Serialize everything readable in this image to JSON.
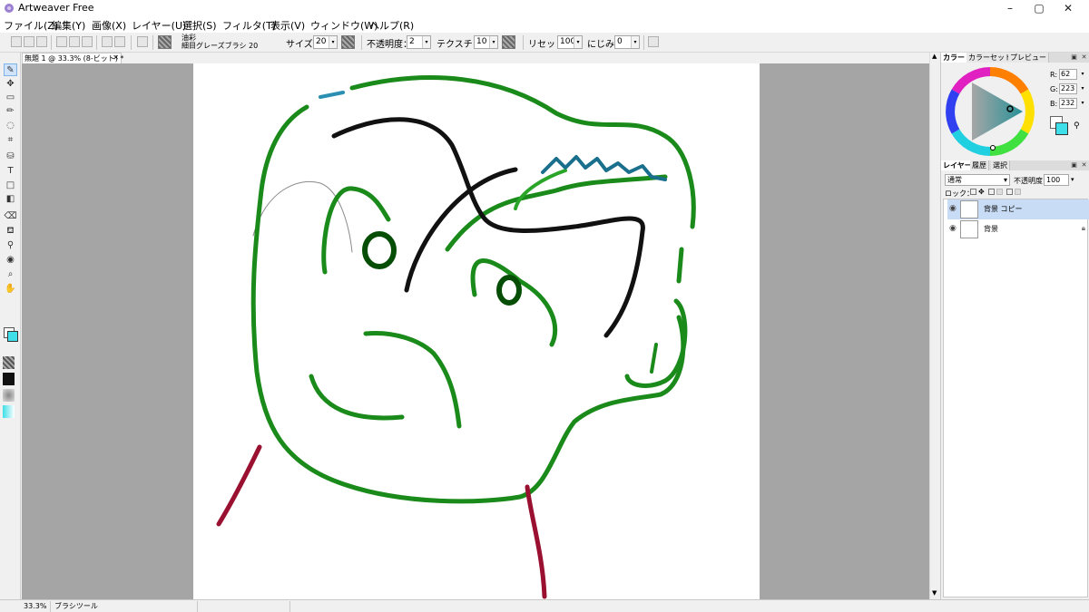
{
  "window": {
    "title": "Artweaver Free",
    "min": "–",
    "max": "▢",
    "close": "✕"
  },
  "menu": [
    "ファイル(Z)",
    "編集(Y)",
    "画像(X)",
    "レイヤー(U)",
    "選択(S)",
    "フィルタ(T)",
    "表示(V)",
    "ウィンドウ(W)",
    "ヘルプ(R)"
  ],
  "toolbar": {
    "brush_category": "油彩",
    "brush_name": "細目グレーズブラシ 20",
    "size_label": "サイズ：",
    "size_value": "20",
    "opacity_label": "不透明度：",
    "opacity_value": "2",
    "texture_label": "テクスチャ：",
    "texture_value": "10",
    "reset_label": "リセット：",
    "reset_value": "100",
    "blur_label": "にじみ：",
    "blur_value": "0"
  },
  "document": {
    "tab_title": "無題 1 @ 33.3% (8-ビット) *",
    "close": "✕"
  },
  "status": {
    "zoom": "33.3%",
    "tool": "ブラシツール"
  },
  "color_panel": {
    "tabs": [
      "カラー",
      "カラーセット",
      "プレビュー"
    ],
    "r_label": "R:",
    "r": "62",
    "g_label": "G:",
    "g": "223",
    "b_label": "B:",
    "b": "232",
    "foreground": "#3edfe8",
    "background": "#ffffff"
  },
  "layers_panel": {
    "tabs": [
      "レイヤー",
      "履歴",
      "選択"
    ],
    "blend_mode": "通常",
    "opacity_label": "不透明度：",
    "opacity": "100",
    "lock_label": "ロック：",
    "layers": [
      {
        "name": "背景 コピー",
        "selected": true
      },
      {
        "name": "背景",
        "selected": false
      }
    ]
  },
  "colors": {
    "green": "#1a8a1a",
    "black": "#111111",
    "teal": "#1a6f8c",
    "crimson": "#9a1030",
    "selection": "#c9dcf5"
  }
}
